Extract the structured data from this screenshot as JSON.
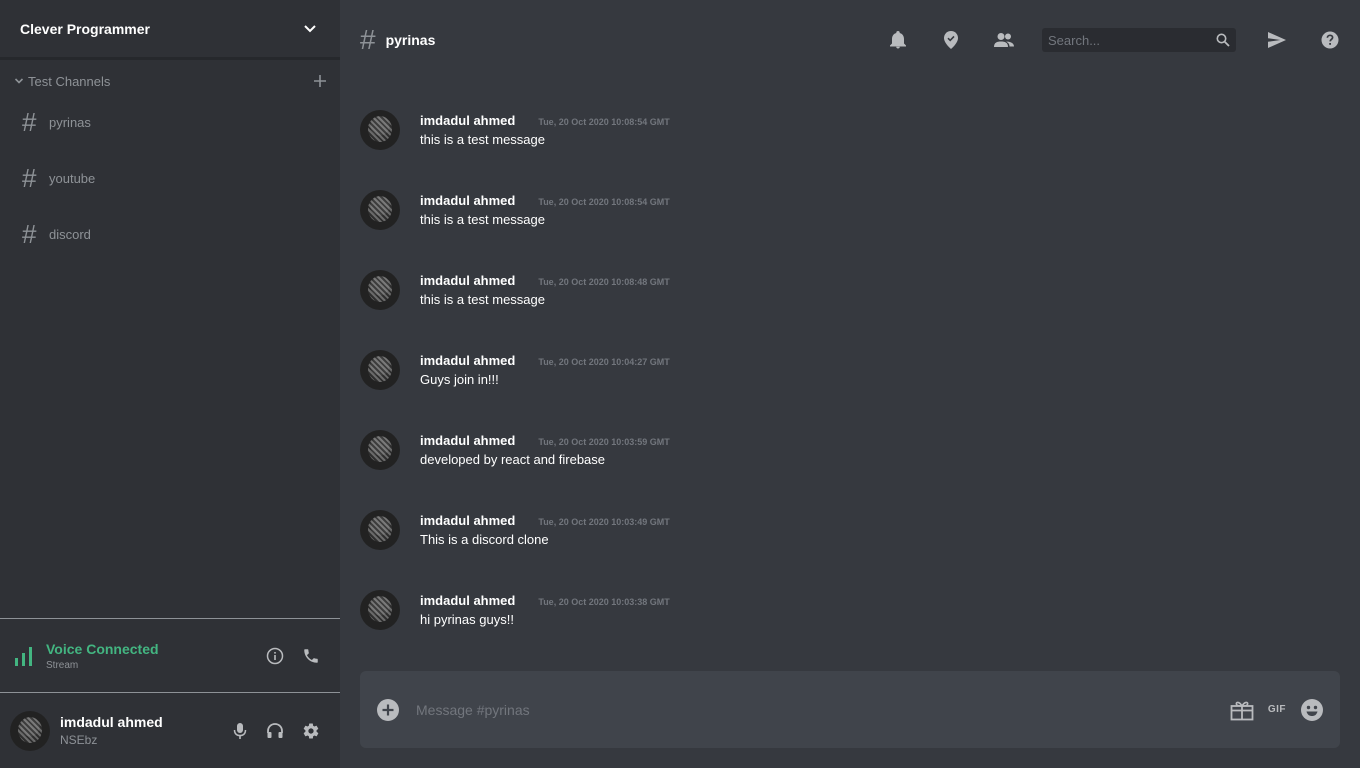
{
  "server": {
    "name": "Clever Programmer"
  },
  "channel_group": {
    "title": "Test Channels"
  },
  "channels": [
    {
      "hash": "#",
      "name": "pyrinas"
    },
    {
      "hash": "#",
      "name": "youtube"
    },
    {
      "hash": "#",
      "name": "discord"
    }
  ],
  "voice": {
    "title": "Voice Connected",
    "subtitle": "Stream"
  },
  "profile": {
    "name": "imdadul ahmed",
    "tag": "NSEbz"
  },
  "chat": {
    "hash": "#",
    "channel": "pyrinas",
    "search_placeholder": "Search...",
    "message_placeholder": "Message #pyrinas",
    "gif_label": "GIF"
  },
  "messages": [
    {
      "author": "imdadul ahmed",
      "time": "Tue, 20 Oct 2020 10:08:54 GMT",
      "text": "this is a test message"
    },
    {
      "author": "imdadul ahmed",
      "time": "Tue, 20 Oct 2020 10:08:54 GMT",
      "text": "this is a test message"
    },
    {
      "author": "imdadul ahmed",
      "time": "Tue, 20 Oct 2020 10:08:48 GMT",
      "text": "this is a test message"
    },
    {
      "author": "imdadul ahmed",
      "time": "Tue, 20 Oct 2020 10:04:27 GMT",
      "text": "Guys join in!!!"
    },
    {
      "author": "imdadul ahmed",
      "time": "Tue, 20 Oct 2020 10:03:59 GMT",
      "text": "developed by react and firebase"
    },
    {
      "author": "imdadul ahmed",
      "time": "Tue, 20 Oct 2020 10:03:49 GMT",
      "text": "This is a discord clone"
    },
    {
      "author": "imdadul ahmed",
      "time": "Tue, 20 Oct 2020 10:03:38 GMT",
      "text": "hi pyrinas guys!!"
    }
  ],
  "icons": {
    "server_menu": "chevron-down-icon",
    "group_toggle": "chevron-down-icon",
    "add_channel": "plus-icon",
    "voice_signal": "signal-bars-icon",
    "voice_info": "info-icon",
    "voice_call": "phone-icon",
    "mic": "microphone-icon",
    "headset": "headset-icon",
    "settings": "gear-icon",
    "notifications": "bell-icon",
    "pins": "location-pin-icon",
    "members": "people-icon",
    "search": "search-icon",
    "send": "send-icon",
    "help": "help-icon",
    "add_attachment": "plus-circle-icon",
    "gift": "gift-icon",
    "emoji": "emoji-icon"
  },
  "colors": {
    "sidebar_bg": "#2f3136",
    "chat_bg": "#36393f",
    "composer_bg": "#40444b",
    "voice_green": "#43b581",
    "muted_text": "#8e9297",
    "white": "#ffffff"
  }
}
